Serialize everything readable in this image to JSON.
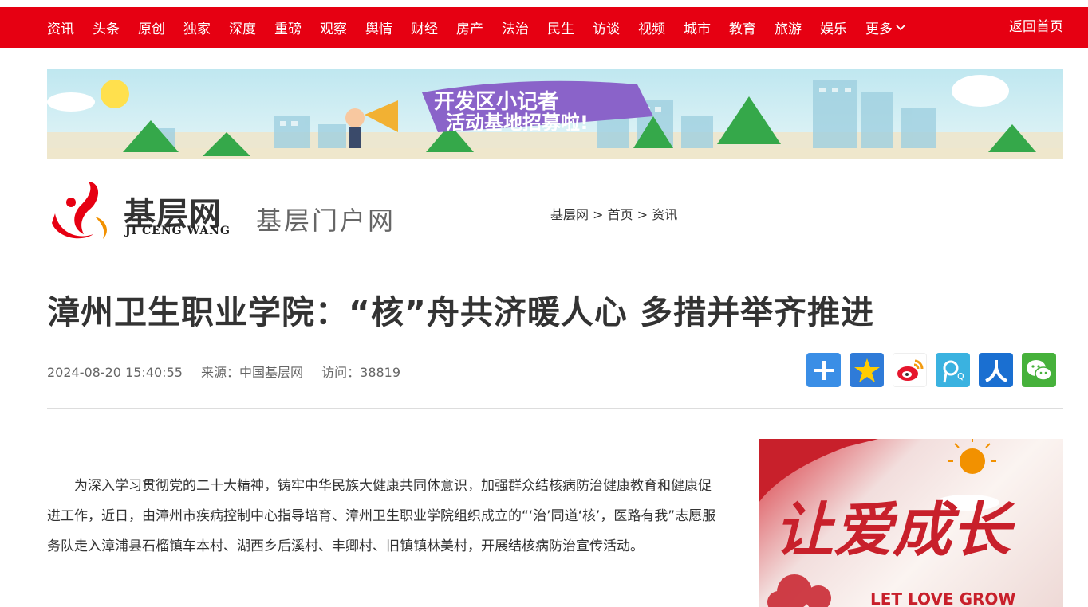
{
  "topnav": {
    "items": [
      "资讯",
      "头条",
      "原创",
      "独家",
      "深度",
      "重磅",
      "观察",
      "舆情",
      "财经",
      "房产",
      "法治",
      "民生",
      "访谈",
      "视频",
      "城市",
      "教育",
      "旅游",
      "娱乐"
    ],
    "more_label": "更多",
    "home_label": "返回首页"
  },
  "banner": {
    "line1": "开发区小记者",
    "line2": "活动基地招募啦!"
  },
  "site": {
    "name": "基层网",
    "name_en": "JI CENG WANG",
    "subtitle": "基层门户网"
  },
  "breadcrumb": [
    "基层网",
    "首页",
    "资讯"
  ],
  "breadcrumb_sep": ">",
  "article": {
    "title": "漳州卫生职业学院：“核”舟共济暖人心 多措并举齐推进",
    "datetime": "2024-08-20 15:40:55",
    "source": "来源：中国基层网",
    "visits": "访问：38819",
    "body": "为深入学习贯彻党的二十大精神，铸牢中华民族大健康共同体意识，加强群众结核病防治健康教育和健康促进工作，近日，由漳州市疾病控制中心指导培育、漳州卫生职业学院组织成立的“‘治’同道‘核’，医路有我”志愿服务队走入漳浦县石榴镇车本村、湖西乡后溪村、丰卿村、旧镇镇林美村，开展结核病防治宣传活动。"
  },
  "share_icons": [
    "plus-share-icon",
    "qzone-star-icon",
    "weibo-icon",
    "tencent-weibo-icon",
    "renren-icon",
    "wechat-icon"
  ],
  "side_image": {
    "text": "让爱成长",
    "text_en": "LET LOVE GROW"
  },
  "colors": {
    "brand_red": "#e60012"
  }
}
